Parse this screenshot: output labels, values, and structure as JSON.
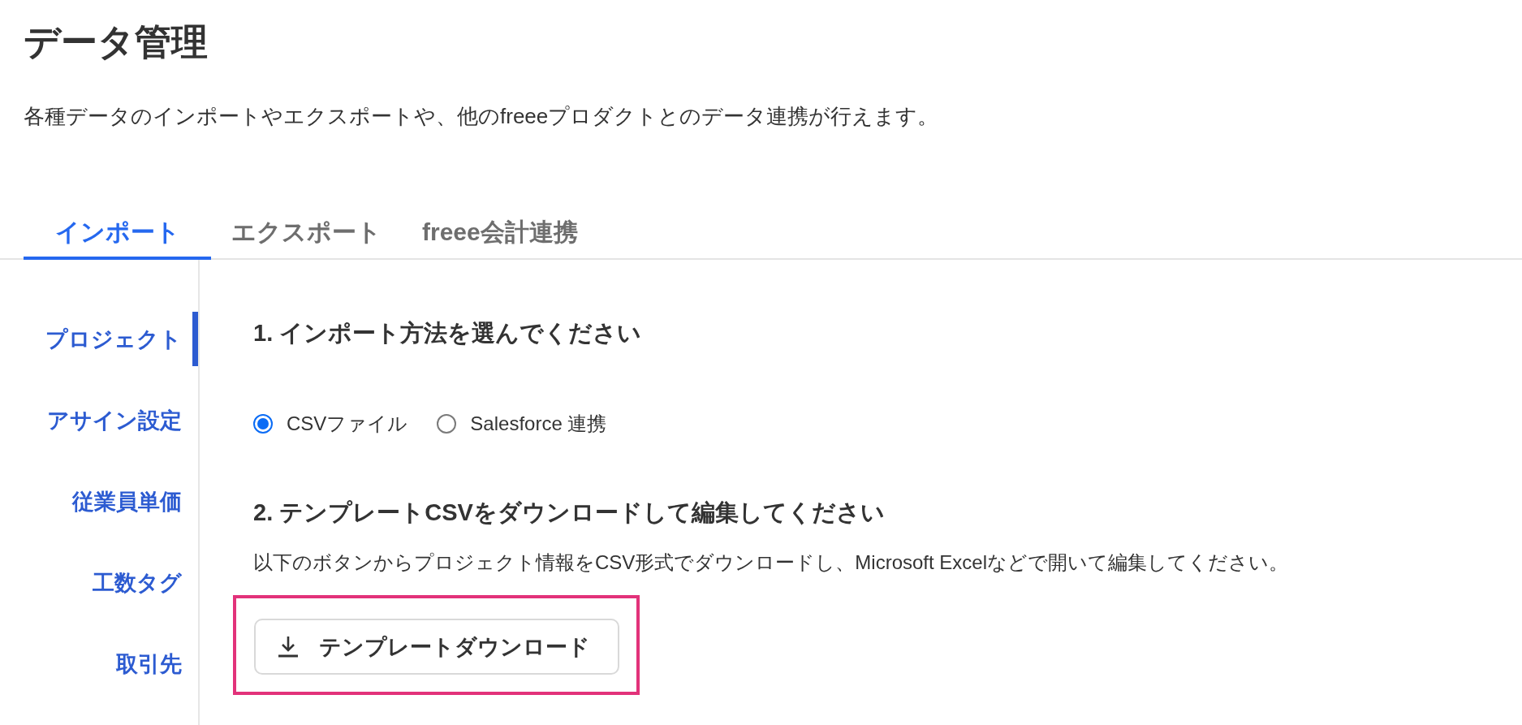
{
  "page": {
    "title": "データ管理",
    "description": "各種データのインポートやエクスポートや、他のfreeeプロダクトとのデータ連携が行えます。"
  },
  "tabs": [
    {
      "label": "インポート",
      "selected": true
    },
    {
      "label": "エクスポート",
      "selected": false
    },
    {
      "label": "freee会計連携",
      "selected": false
    }
  ],
  "sidebar": {
    "items": [
      {
        "label": "プロジェクト",
        "selected": true
      },
      {
        "label": "アサイン設定",
        "selected": false
      },
      {
        "label": "従業員単価",
        "selected": false
      },
      {
        "label": "工数タグ",
        "selected": false
      },
      {
        "label": "取引先",
        "selected": false
      }
    ]
  },
  "steps": [
    {
      "kind": "radio",
      "heading": "1. インポート方法を選んでください",
      "options": [
        {
          "label": "CSVファイル",
          "selected": true
        },
        {
          "label": "Salesforce 連携",
          "selected": false
        }
      ]
    },
    {
      "kind": "download",
      "heading": "2. テンプレートCSVをダウンロードして編集してください",
      "text": "以下のボタンからプロジェクト情報をCSV形式でダウンロードし、Microsoft Excelなどで開いて編集してください。",
      "button": {
        "label": "テンプレートダウンロード",
        "highlighted": true
      }
    }
  ]
}
